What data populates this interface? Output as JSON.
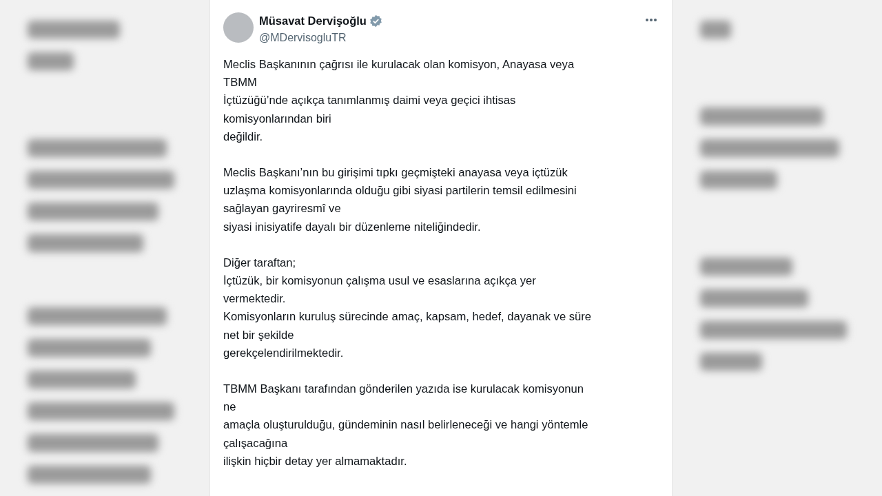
{
  "post": {
    "author": {
      "name": "Müsavat Dervişoğlu",
      "handle": "@MDervisogluTR",
      "verified": true
    },
    "paragraphs": [
      {
        "lines": [
          "Meclis Başkanının çağrısı ile kurulacak olan komisyon, Anayasa veya",
          "TBMM",
          "İçtüzüğü’nde açıkça tanımlanmış daimi veya geçici ihtisas",
          "komisyonlarından biri",
          "değildir."
        ]
      },
      {
        "lines": [
          "Meclis Başkanı’nın bu girişimi tıpkı geçmişteki anayasa veya içtüzük",
          "uzlaşma komisyonlarında olduğu gibi siyasi partilerin temsil edilmesini",
          "sağlayan gayriresmî ve",
          "siyasi inisiyatife dayalı bir düzenleme niteliğindedir."
        ]
      },
      {
        "lines": [
          "Diğer taraftan;",
          "İçtüzük, bir komisyonun çalışma usul ve esaslarına açıkça yer",
          "vermektedir.",
          "Komisyonların kuruluş sürecinde amaç, kapsam, hedef, dayanak ve süre",
          "net bir şekilde",
          "gerekçelendirilmektedir."
        ]
      },
      {
        "lines": [
          "TBMM Başkanı tarafından gönderilen yazıda ise kurulacak komisyonun",
          "ne",
          "amaçla oluşturulduğu, gündeminin nasıl belirleneceği ve hangi yöntemle",
          "çalışacağına",
          "ilişkin hiçbir detay yer almamaktadır."
        ]
      }
    ]
  }
}
